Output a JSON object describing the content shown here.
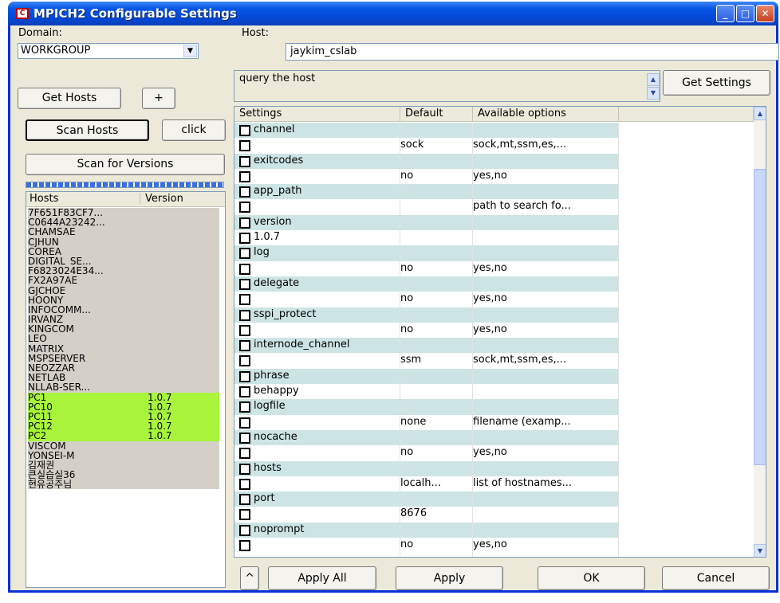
{
  "window": {
    "title": "MPICH2 Configurable Settings"
  },
  "titlebar": {
    "minimize_glyph": "_",
    "maximize_glyph": "□",
    "close_glyph": "✕"
  },
  "left": {
    "domain_label": "Domain:",
    "domain_value": "WORKGROUP",
    "get_hosts_label": "Get Hosts",
    "plus_label": "+",
    "scan_hosts_label": "Scan Hosts",
    "click_label": "click",
    "scan_versions_label": "Scan for Versions",
    "hosts_header": "Hosts",
    "version_header": "Version",
    "hosts": [
      {
        "name": "7F651F83CF7...",
        "version": "",
        "selected": false
      },
      {
        "name": "C0644A23242...",
        "version": "",
        "selected": false
      },
      {
        "name": "CHAMSAE",
        "version": "",
        "selected": false
      },
      {
        "name": "CJHUN",
        "version": "",
        "selected": false
      },
      {
        "name": "COREA",
        "version": "",
        "selected": false
      },
      {
        "name": "DIGITAL_SE...",
        "version": "",
        "selected": false
      },
      {
        "name": "F6823024E34...",
        "version": "",
        "selected": false
      },
      {
        "name": "FX2A97AE",
        "version": "",
        "selected": false
      },
      {
        "name": "GJCHOE",
        "version": "",
        "selected": false
      },
      {
        "name": "HOONY",
        "version": "",
        "selected": false
      },
      {
        "name": "INFOCOMM...",
        "version": "",
        "selected": false
      },
      {
        "name": "IRVANZ",
        "version": "",
        "selected": false
      },
      {
        "name": "KINGCOM",
        "version": "",
        "selected": false
      },
      {
        "name": "LEO",
        "version": "",
        "selected": false
      },
      {
        "name": "MATRIX",
        "version": "",
        "selected": false
      },
      {
        "name": "MSPSERVER",
        "version": "",
        "selected": false
      },
      {
        "name": "NEOZZAR",
        "version": "",
        "selected": false
      },
      {
        "name": "NETLAB",
        "version": "",
        "selected": false
      },
      {
        "name": "NLLAB-SER...",
        "version": "",
        "selected": false
      },
      {
        "name": "PC1",
        "version": "1.0.7",
        "selected": true
      },
      {
        "name": "PC10",
        "version": "1.0.7",
        "selected": true
      },
      {
        "name": "PC11",
        "version": "1.0.7",
        "selected": true
      },
      {
        "name": "PC12",
        "version": "1.0.7",
        "selected": true
      },
      {
        "name": "PC2",
        "version": "1.0.7",
        "selected": true
      },
      {
        "name": "VISCOM",
        "version": "",
        "selected": false
      },
      {
        "name": "YONSEI-M",
        "version": "",
        "selected": false
      },
      {
        "name": "김재권",
        "version": "",
        "selected": false
      },
      {
        "name": "큰실습실36",
        "version": "",
        "selected": false
      },
      {
        "name": "현유공주님",
        "version": "",
        "selected": false
      }
    ]
  },
  "right": {
    "host_label": "Host:",
    "host_value": "jaykim_cslab",
    "query_text": "query the host",
    "get_settings_label": "Get Settings",
    "columns": [
      "Settings",
      "Default",
      "Available options"
    ],
    "rows": [
      {
        "name": true,
        "text": "channel",
        "default": "",
        "options": ""
      },
      {
        "name": false,
        "text": "",
        "default": "sock",
        "options": "sock,mt,ssm,es,..."
      },
      {
        "name": true,
        "text": "exitcodes",
        "default": "",
        "options": ""
      },
      {
        "name": false,
        "text": "",
        "default": "no",
        "options": "yes,no"
      },
      {
        "name": true,
        "text": "app_path",
        "default": "",
        "options": ""
      },
      {
        "name": false,
        "text": "",
        "default": "",
        "options": "path to search fo..."
      },
      {
        "name": true,
        "text": "version",
        "default": "",
        "options": ""
      },
      {
        "name": false,
        "text": "1.0.7",
        "default": "",
        "options": ""
      },
      {
        "name": true,
        "text": "log",
        "default": "",
        "options": ""
      },
      {
        "name": false,
        "text": "",
        "default": "no",
        "options": "yes,no"
      },
      {
        "name": true,
        "text": "delegate",
        "default": "",
        "options": ""
      },
      {
        "name": false,
        "text": "",
        "default": "no",
        "options": "yes,no"
      },
      {
        "name": true,
        "text": "sspi_protect",
        "default": "",
        "options": ""
      },
      {
        "name": false,
        "text": "",
        "default": "no",
        "options": "yes,no"
      },
      {
        "name": true,
        "text": "internode_channel",
        "default": "",
        "options": ""
      },
      {
        "name": false,
        "text": "",
        "default": "ssm",
        "options": "sock,mt,ssm,es,..."
      },
      {
        "name": true,
        "text": "phrase",
        "default": "",
        "options": ""
      },
      {
        "name": false,
        "text": "behappy",
        "default": "",
        "options": ""
      },
      {
        "name": true,
        "text": "logfile",
        "default": "",
        "options": ""
      },
      {
        "name": false,
        "text": "",
        "default": "none",
        "options": "filename (examp..."
      },
      {
        "name": true,
        "text": "nocache",
        "default": "",
        "options": ""
      },
      {
        "name": false,
        "text": "",
        "default": "no",
        "options": "yes,no"
      },
      {
        "name": true,
        "text": "hosts",
        "default": "",
        "options": ""
      },
      {
        "name": false,
        "text": "",
        "default": "localh...",
        "options": "list of hostnames..."
      },
      {
        "name": true,
        "text": "port",
        "default": "",
        "options": ""
      },
      {
        "name": false,
        "text": "",
        "default": "8676",
        "options": ""
      },
      {
        "name": true,
        "text": "noprompt",
        "default": "",
        "options": ""
      },
      {
        "name": false,
        "text": "",
        "default": "no",
        "options": "yes,no"
      }
    ],
    "buttons": {
      "toggle": "^",
      "apply_all": "Apply All",
      "apply": "Apply",
      "ok": "OK",
      "cancel": "Cancel"
    }
  },
  "colors": {
    "selected_host": "#a8f53b",
    "setting_name_row": "#cde4e4",
    "title_blue": "#0655e3"
  }
}
